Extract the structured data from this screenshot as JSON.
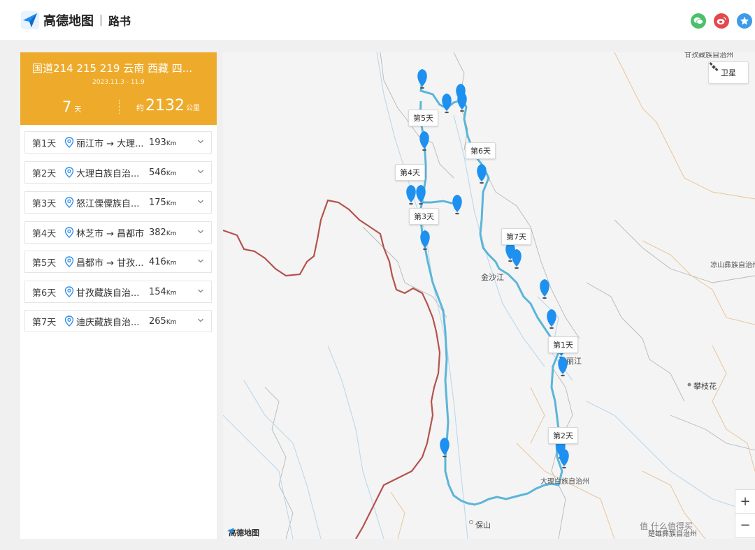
{
  "brand": {
    "name": "高德地图",
    "section": "路书",
    "map_brand": "高德地图"
  },
  "share": [
    {
      "name": "wechat-icon",
      "color": "#4cbf6b"
    },
    {
      "name": "weibo-icon",
      "color": "#e6474b"
    },
    {
      "name": "favorite-icon",
      "color": "#3d9be9"
    }
  ],
  "route": {
    "title": "国道214 215 219 云南 西藏 四...",
    "date": "2023.11.3 - 11.9",
    "days": "7",
    "days_unit": "天",
    "distance_prefix": "约",
    "distance": "2132",
    "distance_unit": "公里"
  },
  "days": [
    {
      "label": "第1天",
      "stops": "丽江市 → 大理...",
      "dist": "193",
      "unit": "Km"
    },
    {
      "label": "第2天",
      "stops": "大理白族自治...",
      "dist": "546",
      "unit": "Km"
    },
    {
      "label": "第3天",
      "stops": "怒江傈僳族自...",
      "dist": "175",
      "unit": "Km"
    },
    {
      "label": "第4天",
      "stops": "林芝市 → 昌都市",
      "dist": "382",
      "unit": "Km"
    },
    {
      "label": "第5天",
      "stops": "昌都市 → 甘孜...",
      "dist": "416",
      "unit": "Km"
    },
    {
      "label": "第6天",
      "stops": "甘孜藏族自治...",
      "dist": "154",
      "unit": "Km"
    },
    {
      "label": "第7天",
      "stops": "迪庆藏族自治...",
      "dist": "265",
      "unit": "Km"
    }
  ],
  "map": {
    "satellite_label": "卫星",
    "zoom_in": "+",
    "zoom_out": "−",
    "labels": {
      "jinshajiang": "金沙江",
      "lijiang": "丽江",
      "panzhihua": "攀枝花",
      "dali": "大理白族自治州",
      "baoshan": "保山",
      "liangshan": "凉山彝族自治州",
      "ganzi": "甘孜藏族自治州",
      "chuxiong": "楚雄彝族自治州"
    },
    "day_tags": [
      "第5天",
      "第6天",
      "第4天",
      "第3天",
      "第7天",
      "第1天",
      "第2天"
    ],
    "route_color": "#5bb5d9",
    "marker_color": "#1e90f0",
    "border_color": "#b5524d"
  },
  "watermark": "值 什么值得买"
}
